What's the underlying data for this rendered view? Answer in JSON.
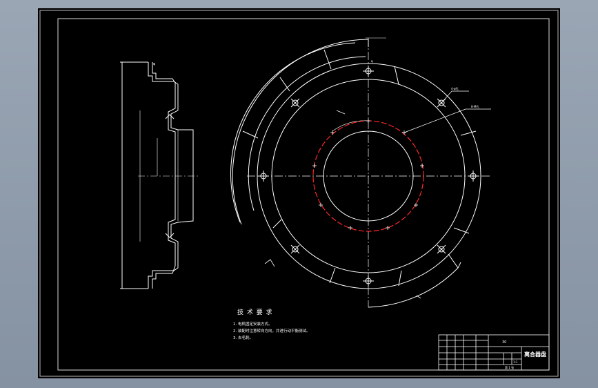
{
  "notes": {
    "title": "技 术 要 求",
    "lines": [
      "1. 电机固定安装方式。",
      "2. 装配时注意转向方向，并进行动平衡测试。",
      "3. 去毛刺。"
    ]
  },
  "title_block": {
    "drawing_name": "离合器盘",
    "code": "30",
    "scale": "1:1",
    "sheet": "第 1 张"
  },
  "colors": {
    "background": "#000000",
    "line": "#ffffff",
    "bolt_circle": "#ff2a2a",
    "frame": "#c8c8c8",
    "page": "#8c98a8"
  }
}
